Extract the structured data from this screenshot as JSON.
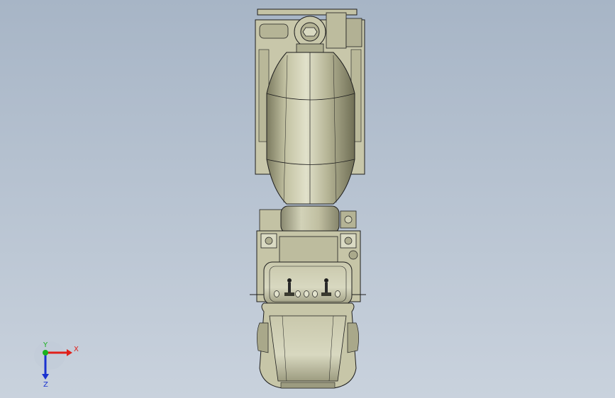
{
  "viewport": {
    "background_top": "#a7b5c6",
    "background_bottom": "#c9d2dd",
    "model_color": "#b9b898",
    "model_shadow": "#8f8d70",
    "model_highlight": "#dcdcc2",
    "edge_color": "#1e1e1e"
  },
  "triad": {
    "x_label": "X",
    "y_label": "Y",
    "z_label": "Z",
    "x_color": "#e0201a",
    "y_color": "#19b21e",
    "z_color": "#1a32d0"
  }
}
